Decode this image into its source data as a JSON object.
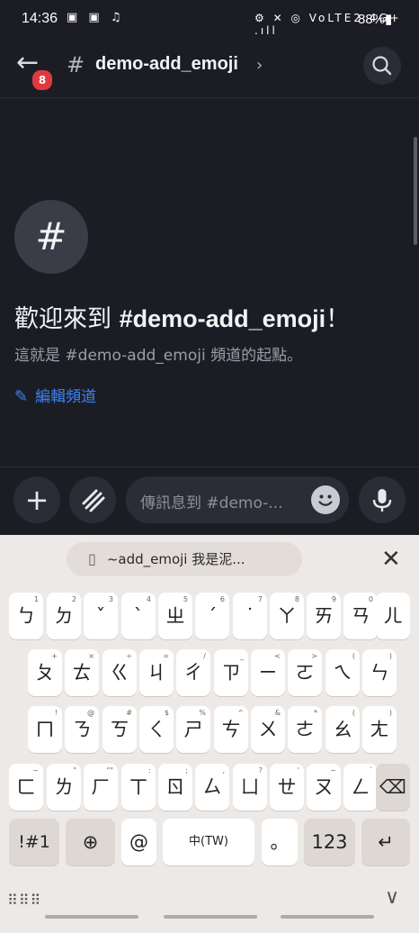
{
  "status_bar": {
    "time": "14:36",
    "left_icons": "▣ ▣ ♫",
    "right_icons": "⚙ ✕ ◎ VoLTE2 4G+ .ıll",
    "battery": "88%▮"
  },
  "header": {
    "back_icon": "←",
    "badge": "8",
    "hash": "#",
    "title": "demo-add_emoji",
    "chevron": "›"
  },
  "welcome": {
    "big_hash": "#",
    "prefix": "歡迎來到 ",
    "channel": "#demo-add_emoji",
    "suffix": "！",
    "subtitle": "這就是 #demo-add_emoji 頻道的起點。",
    "edit_label": "編輯頻道",
    "edit_icon": "✎"
  },
  "composer": {
    "plus": "+",
    "apps": "≋",
    "placeholder": "傳訊息到 #demo-..."
  },
  "keyboard": {
    "clipboard_text": "~add_emoji 我是泥...",
    "clipboard_icon": "▯",
    "close": "✕",
    "rows": [
      [
        {
          "k": "ㄅ",
          "h": "1"
        },
        {
          "k": "ㄉ",
          "h": "2"
        },
        {
          "k": "ˇ",
          "h": "3"
        },
        {
          "k": "ˋ",
          "h": "4"
        },
        {
          "k": "ㄓ",
          "h": "5"
        },
        {
          "k": "ˊ",
          "h": "6"
        },
        {
          "k": "˙",
          "h": "7"
        },
        {
          "k": "ㄚ",
          "h": "8"
        },
        {
          "k": "ㄞ",
          "h": "9"
        },
        {
          "k": "ㄢ",
          "h": "0"
        },
        {
          "k": "ㄦ",
          "h": ""
        }
      ],
      [
        {
          "k": "ㄆ",
          "h": "+"
        },
        {
          "k": "ㄊ",
          "h": "×"
        },
        {
          "k": "ㄍ",
          "h": "÷"
        },
        {
          "k": "ㄐ",
          "h": "="
        },
        {
          "k": "ㄔ",
          "h": "/"
        },
        {
          "k": "ㄗ",
          "h": "_"
        },
        {
          "k": "ㄧ",
          "h": "<"
        },
        {
          "k": "ㄛ",
          "h": ">"
        },
        {
          "k": "ㄟ",
          "h": "("
        },
        {
          "k": "ㄣ",
          "h": ")"
        }
      ],
      [
        {
          "k": "ㄇ",
          "h": "!"
        },
        {
          "k": "ㄋ",
          "h": "@"
        },
        {
          "k": "ㄎ",
          "h": "#"
        },
        {
          "k": "ㄑ",
          "h": "$"
        },
        {
          "k": "ㄕ",
          "h": "%"
        },
        {
          "k": "ㄘ",
          "h": "^"
        },
        {
          "k": "ㄨ",
          "h": "&"
        },
        {
          "k": "ㄜ",
          "h": "*"
        },
        {
          "k": "ㄠ",
          "h": "("
        },
        {
          "k": "ㄤ",
          "h": ")"
        }
      ],
      [
        {
          "k": "ㄈ",
          "h": "~"
        },
        {
          "k": "ㄌ",
          "h": "\""
        },
        {
          "k": "ㄏ",
          "h": "\"\""
        },
        {
          "k": "ㄒ",
          "h": ":"
        },
        {
          "k": "ㄖ",
          "h": ";"
        },
        {
          "k": "ㄙ",
          "h": ","
        },
        {
          "k": "ㄩ",
          "h": "?"
        },
        {
          "k": "ㄝ",
          "h": "'"
        },
        {
          "k": "ㄡ",
          "h": "~"
        },
        {
          "k": "ㄥ",
          "h": "`"
        }
      ]
    ],
    "backspace": "⌫",
    "sym": "!#1",
    "globe": "⊕",
    "at": "@",
    "space": "中(TW)",
    "period": "。",
    "num": "123",
    "enter": "↵",
    "footer_dots": "⠿⠿⠿",
    "hide": "∨"
  }
}
